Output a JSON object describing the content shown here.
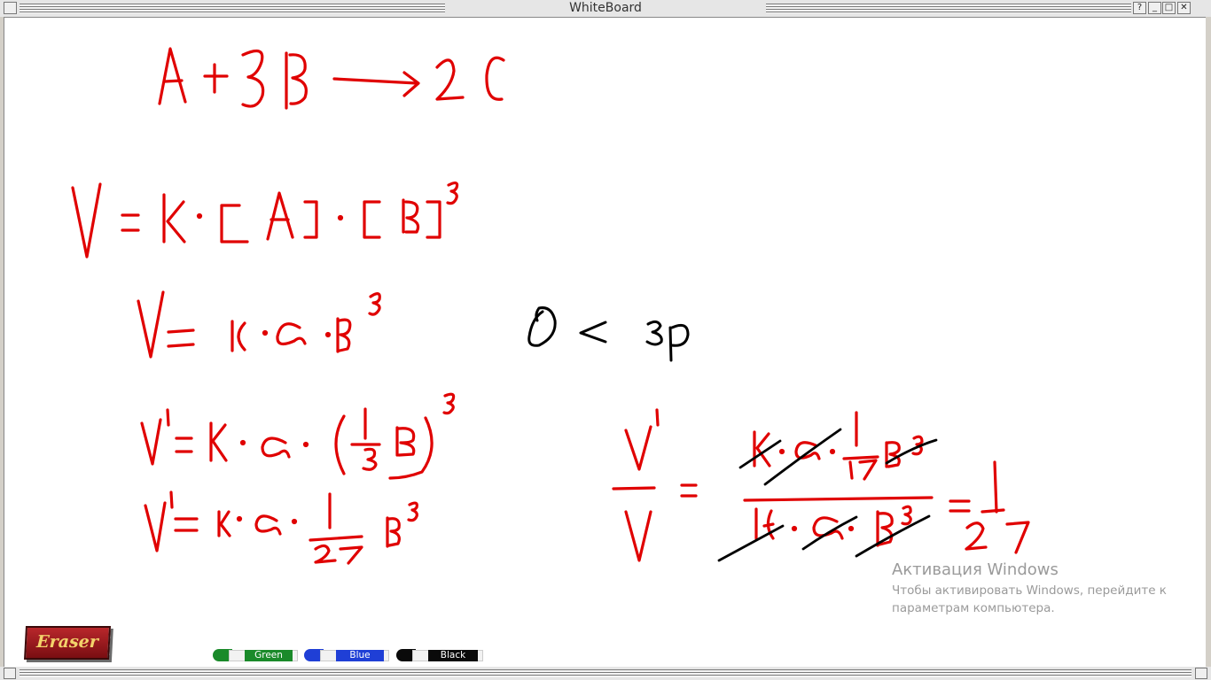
{
  "window": {
    "title": "WhiteBoard",
    "help_button": "?",
    "minimize_button": "_",
    "maximize_button": "□",
    "close_button": "✕"
  },
  "toolbar": {
    "eraser_label": "Eraser",
    "markers": [
      {
        "label": "Green",
        "color": "#1a8a2a"
      },
      {
        "label": "Blue",
        "color": "#1f3fd6"
      },
      {
        "label": "Black",
        "color": "#0a0a0a"
      }
    ]
  },
  "watermark": {
    "title": "Активация Windows",
    "text": "Чтобы активировать Windows, перейдите к параметрам компьютера."
  },
  "ink_colors": {
    "red": "#e00000",
    "black": "#000000"
  }
}
